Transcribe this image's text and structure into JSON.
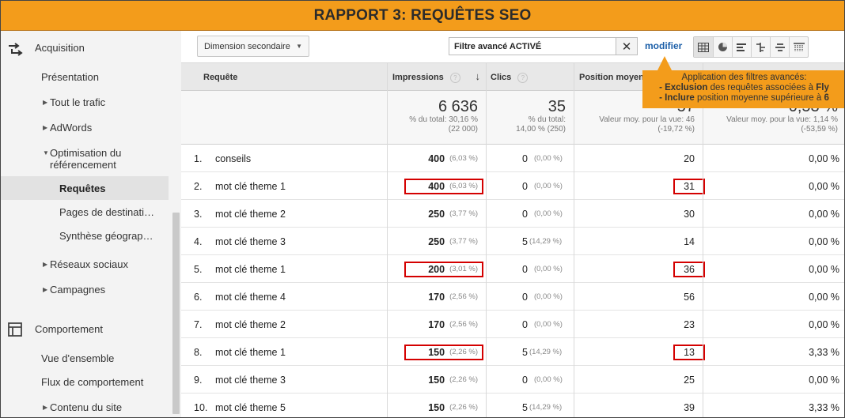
{
  "title": "RAPPORT 3: REQUÊTES SEO",
  "sidebar": {
    "acquisition": "Acquisition",
    "presentation": "Présentation",
    "tout_trafic": "Tout le trafic",
    "adwords": "AdWords",
    "optimisation_line1": "Optimisation du",
    "optimisation_line2": "référencement",
    "requetes": "Requêtes",
    "pages_destination": "Pages de destinati…",
    "synthese": "Synthèse géograp…",
    "reseaux": "Réseaux sociaux",
    "campagnes": "Campagnes",
    "comportement": "Comportement",
    "vue_ensemble": "Vue d'ensemble",
    "flux": "Flux de comportement",
    "contenu": "Contenu du site"
  },
  "toolbar": {
    "secondary_dimension": "Dimension secondaire",
    "filter_text": "Filtre avancé ACTIVÉ",
    "clear": "✕",
    "modifier": "modifier",
    "view_icons": [
      "table-view-icon",
      "pie-view-icon",
      "bar-view-icon",
      "comparison-view-icon",
      "term-cloud-view-icon",
      "pivot-view-icon"
    ]
  },
  "table": {
    "headers": {
      "requete": "Requête",
      "impressions": "Impressions",
      "clics": "Clics",
      "position": "Position moyenne",
      "ctr": ""
    },
    "totals": {
      "impressions": "6 636",
      "impressions_sub1": "% du total: 30,16 %",
      "impressions_sub2": "(22 000)",
      "clics": "35",
      "clics_sub1": "% du total:",
      "clics_sub2": "14,00 % (250)",
      "position": "57",
      "position_sub1": "Valeur moy. pour la vue: 46",
      "position_sub2": "(-19,72 %)",
      "ctr": "0,53 %",
      "ctr_sub1": "Valeur moy. pour la vue: 1,14 %",
      "ctr_sub2": "(-53,59 %)"
    },
    "rows": [
      {
        "idx": "1.",
        "query": "conseils",
        "impr": "400",
        "impr_pct": "(6,03 %)",
        "clics": "0",
        "clics_pct": "(0,00 %)",
        "pos": "20",
        "ctr": "0,00 %"
      },
      {
        "idx": "2.",
        "query": "mot clé theme 1",
        "impr": "400",
        "impr_pct": "(6,03 %)",
        "clics": "0",
        "clics_pct": "(0,00 %)",
        "pos": "31",
        "ctr": "0,00 %"
      },
      {
        "idx": "3.",
        "query": "mot clé theme 2",
        "impr": "250",
        "impr_pct": "(3,77 %)",
        "clics": "0",
        "clics_pct": "(0,00 %)",
        "pos": "30",
        "ctr": "0,00 %"
      },
      {
        "idx": "4.",
        "query": "mot clé theme 3",
        "impr": "250",
        "impr_pct": "(3,77 %)",
        "clics": "5",
        "clics_pct": "(14,29 %)",
        "pos": "14",
        "ctr": "0,00 %"
      },
      {
        "idx": "5.",
        "query": "mot clé theme 1",
        "impr": "200",
        "impr_pct": "(3,01 %)",
        "clics": "0",
        "clics_pct": "(0,00 %)",
        "pos": "36",
        "ctr": "0,00 %"
      },
      {
        "idx": "6.",
        "query": "mot clé theme 4",
        "impr": "170",
        "impr_pct": "(2,56 %)",
        "clics": "0",
        "clics_pct": "(0,00 %)",
        "pos": "56",
        "ctr": "0,00 %"
      },
      {
        "idx": "7.",
        "query": "mot clé theme 2",
        "impr": "170",
        "impr_pct": "(2,56 %)",
        "clics": "0",
        "clics_pct": "(0,00 %)",
        "pos": "23",
        "ctr": "0,00 %"
      },
      {
        "idx": "8.",
        "query": "mot clé theme 1",
        "impr": "150",
        "impr_pct": "(2,26 %)",
        "clics": "5",
        "clics_pct": "(14,29 %)",
        "pos": "13",
        "ctr": "3,33 %"
      },
      {
        "idx": "9.",
        "query": "mot clé theme 3",
        "impr": "150",
        "impr_pct": "(2,26 %)",
        "clics": "0",
        "clics_pct": "(0,00 %)",
        "pos": "25",
        "ctr": "0,00 %"
      },
      {
        "idx": "10.",
        "query": "mot clé theme 5",
        "impr": "150",
        "impr_pct": "(2,26 %)",
        "clics": "5",
        "clics_pct": "(14,29 %)",
        "pos": "39",
        "ctr": "3,33 %"
      }
    ]
  },
  "tooltip": {
    "line1": "Application des filtres avancés:",
    "line2_bold": "- Exclusion",
    "line2_rest": " des requêtes associées à ",
    "line2_end": "Fly",
    "line3_bold": "- Inclure",
    "line3_rest": " position moyenne supérieure à ",
    "line3_end": "6"
  },
  "colors": {
    "banner": "#f39c1b",
    "highlight": "#d40000",
    "link": "#1c5fa8"
  }
}
